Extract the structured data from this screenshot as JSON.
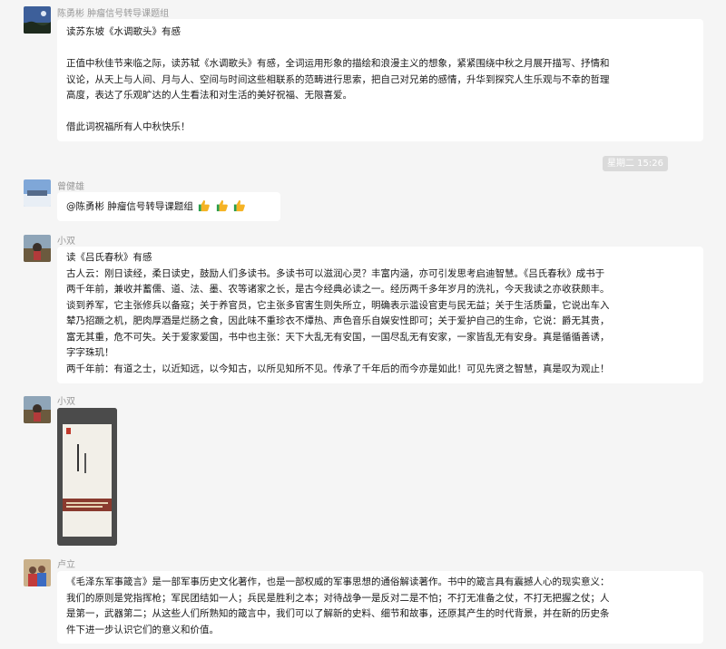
{
  "messages": [
    {
      "sender": "陈勇彬 肿瘤信号转导课题组",
      "lines": [
        "读苏东坡《水调歌头》有感",
        "",
        "正值中秋佳节来临之际，读苏轼《水调歌头》有感，全词运用形象的描绘和浪漫主义的想象，紧紧围绕中秋之月展开描写、抒情和",
        "议论，从天上与人间、月与人、空间与时间这些相联系的范畴进行思索，把自己对兄弟的感情，升华到探究人生乐观与不幸的哲理",
        "高度，表达了乐观旷达的人生看法和对生活的美好祝福、无限喜爱。",
        "",
        "借此词祝福所有人中秋快乐！"
      ]
    },
    {
      "sender": "曾健雄",
      "text": "@陈勇彬 肿瘤信号转导课题组",
      "emoji": "thumbs-up-icon"
    },
    {
      "sender": "小双",
      "lines": [
        "读《吕氏春秋》有感",
        "古人云：刚日读经，柔日读史，鼓励人们多读书。多读书可以滋润心灵？丰富内涵，亦可引发思考启迪智慧。《吕氏春秋》成书于",
        "两千年前，兼收并蓄儒、道、法、墨、农等诸家之长，是古今经典必读之一。经历两千多年岁月的洗礼，今天我读之亦收获颇丰。",
        "谈到养军，它主张修兵以备寇；关于养官员，它主张多官害生则失所立，明确表示滥设官吏与民无益；关于生活质量，它说出车入",
        "辇乃招蹶之机，肥肉厚酒是烂肠之食，因此味不重珍衣不燂热、声色音乐自娱安性即可；关于爱护自己的生命，它说：爵无其贵，",
        "富无其重，危不可失。关于爱家爱国，书中也主张：天下大乱无有安国，一国尽乱无有安家，一家皆乱无有安身。真是循循善诱，",
        "字字珠玑！",
        "两千年前：有道之士，以近知远，以今知古，以所见知所不见。传承了千年后的而今亦是如此！可见先贤之智慧，真是叹为观止！"
      ]
    },
    {
      "sender": "小双",
      "image": "book-photo"
    },
    {
      "sender": "卢立",
      "lines": [
        "《毛泽东军事箴言》是一部军事历史文化著作，也是一部权威的军事思想的通俗解读著作。书中的箴言具有震撼人心的现实意义：",
        "我们的原则是党指挥枪；军民团结如一人；兵民是胜利之本；对待战争一是反对二是不怕；不打无准备之仗，不打无把握之仗；人",
        "是第一，武器第二；从这些人们所熟知的箴言中，我们可以了解新的史料、细节和故事，还原其产生的时代背景，并在新的历史条",
        "件下进一步认识它们的意义和价值。"
      ]
    }
  ],
  "timestamp": "星期二 15:26",
  "colors": {
    "background": "#f5f5f5",
    "bubble": "#ffffff",
    "sender": "#999999",
    "timestamp_bg": "#dadada"
  }
}
